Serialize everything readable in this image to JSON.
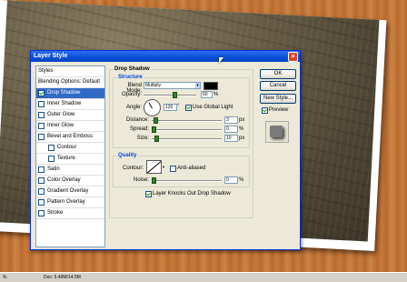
{
  "dialog": {
    "title": "Layer Style",
    "close_glyph": "×"
  },
  "styles": {
    "items": [
      {
        "label": "Styles",
        "checkbox": false,
        "checked": false,
        "indent": false,
        "active": false
      },
      {
        "label": "Blending Options: Default",
        "checkbox": false,
        "checked": false,
        "indent": false,
        "active": false
      },
      {
        "label": "Drop Shadow",
        "checkbox": true,
        "checked": true,
        "indent": false,
        "active": true
      },
      {
        "label": "Inner Shadow",
        "checkbox": true,
        "checked": false,
        "indent": false,
        "active": false
      },
      {
        "label": "Outer Glow",
        "checkbox": true,
        "checked": false,
        "indent": false,
        "active": false
      },
      {
        "label": "Inner Glow",
        "checkbox": true,
        "checked": false,
        "indent": false,
        "active": false
      },
      {
        "label": "Bevel and Emboss",
        "checkbox": true,
        "checked": false,
        "indent": false,
        "active": false
      },
      {
        "label": "Contour",
        "checkbox": true,
        "checked": false,
        "indent": true,
        "active": false
      },
      {
        "label": "Texture",
        "checkbox": true,
        "checked": false,
        "indent": true,
        "active": false
      },
      {
        "label": "Satin",
        "checkbox": true,
        "checked": false,
        "indent": false,
        "active": false
      },
      {
        "label": "Color Overlay",
        "checkbox": true,
        "checked": false,
        "indent": false,
        "active": false
      },
      {
        "label": "Gradient Overlay",
        "checkbox": true,
        "checked": false,
        "indent": false,
        "active": false
      },
      {
        "label": "Pattern Overlay",
        "checkbox": true,
        "checked": false,
        "indent": false,
        "active": false
      },
      {
        "label": "Stroke",
        "checkbox": true,
        "checked": false,
        "indent": false,
        "active": false
      }
    ]
  },
  "drop_shadow": {
    "title": "Drop Shadow",
    "structure": {
      "title": "Structure",
      "blend_mode_label": "Blend Mode:",
      "blend_mode_value": "Multiply",
      "shadow_color": "#000000",
      "opacity_label": "Opacity:",
      "opacity_value": "60",
      "opacity_unit": "%",
      "opacity_level": 0.6,
      "angle_label": "Angle:",
      "angle_value": "120",
      "angle_unit": "°",
      "global_light_label": "Use Global Light",
      "global_light_checked": true,
      "distance_label": "Distance:",
      "distance_value": "3",
      "distance_unit": "px",
      "distance_level": 0.03,
      "spread_label": "Spread:",
      "spread_value": "0",
      "spread_unit": "%",
      "spread_level": 0.0,
      "size_label": "Size:",
      "size_value": "10",
      "size_unit": "px",
      "size_level": 0.04
    },
    "quality": {
      "title": "Quality",
      "contour_label": "Contour:",
      "anti_aliased_label": "Anti-aliased",
      "anti_aliased_checked": false,
      "noise_label": "Noise:",
      "noise_value": "0",
      "noise_unit": "%",
      "noise_level": 0.0
    },
    "knockout_label": "Layer Knocks Out Drop Shadow",
    "knockout_checked": true
  },
  "buttons": {
    "ok": "OK",
    "cancel": "Cancel",
    "new_style": "New Style...",
    "preview": "Preview",
    "preview_checked": true
  },
  "status": {
    "zoom": "%",
    "doc": "Doc: 5.49M/14.5M"
  }
}
